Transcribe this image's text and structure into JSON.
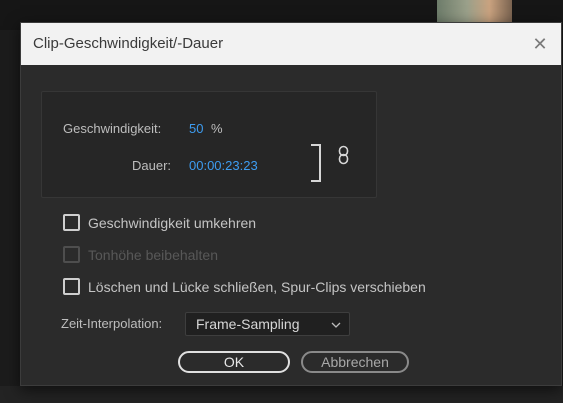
{
  "dialog": {
    "title": "Clip-Geschwindigkeit/-Dauer",
    "close_glyph": "✕"
  },
  "speed": {
    "label": "Geschwindigkeit:",
    "value": "50",
    "unit": "%"
  },
  "duration": {
    "label": "Dauer:",
    "value": "00:00:23:23"
  },
  "options": [
    {
      "label": "Geschwindigkeit umkehren",
      "checked": false,
      "enabled": true
    },
    {
      "label": "Tonhöhe beibehalten",
      "checked": false,
      "enabled": false
    },
    {
      "label": "Löschen und Lücke schließen, Spur-Clips verschieben",
      "checked": false,
      "enabled": true
    }
  ],
  "interpolation": {
    "label": "Zeit-Interpolation:",
    "selected": "Frame-Sampling"
  },
  "buttons": {
    "ok": "OK",
    "cancel": "Abbrechen"
  },
  "colors": {
    "accent_value": "#3d9cf0",
    "dialog_bg": "#2b2b2b",
    "titlebar_bg": "#f2f2f2"
  }
}
